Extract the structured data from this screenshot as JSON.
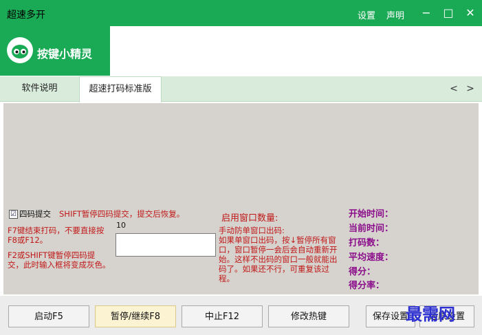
{
  "window": {
    "title": "超速多开",
    "links": [
      "设置",
      "声明"
    ],
    "controls": {
      "minimize": "−",
      "maximize": "□",
      "close": "✕"
    }
  },
  "logo": {
    "text": "按键小精灵"
  },
  "tabs": [
    {
      "label": "软件说明",
      "active": false
    },
    {
      "label": "超速打码标准版",
      "active": true
    }
  ],
  "tab_nav": {
    "prev": "<",
    "next": ">"
  },
  "left_panel": {
    "checkbox_checked": "☑",
    "checkbox_label": "四码提交",
    "shift_note": "SHIFT暂停四码提交，提交后恢复。",
    "f7_note": "F7键结束打码，不要直接按F8或F12。",
    "f2_note": "F2或SHIFT键暂停四码提交，此时输入框将变成灰色。",
    "input_number": "10",
    "input_value": ""
  },
  "middle_panel": {
    "window_count": "启用窗口数量:",
    "manual_title": "手动防单窗口出码:",
    "manual_desc": "如果单窗口出码，按↓暂停所有窗口，窗口暂停一会后会自动重新开始。这样不出码的窗口一般就能出码了。如果还不行，可重复该过程。"
  },
  "stats": [
    {
      "label": "开始时间："
    },
    {
      "label": "当前时间："
    },
    {
      "label": "打码数："
    },
    {
      "label": "平均速度："
    },
    {
      "label": "得分："
    },
    {
      "label": "得分率："
    }
  ],
  "buttons": {
    "start": "启动F5",
    "pause": "暂停/继续F8",
    "stop": "中止F12",
    "hotkeys": "修改热键",
    "save": "保存设置",
    "restore": "还原设置"
  },
  "watermark": "最需网"
}
